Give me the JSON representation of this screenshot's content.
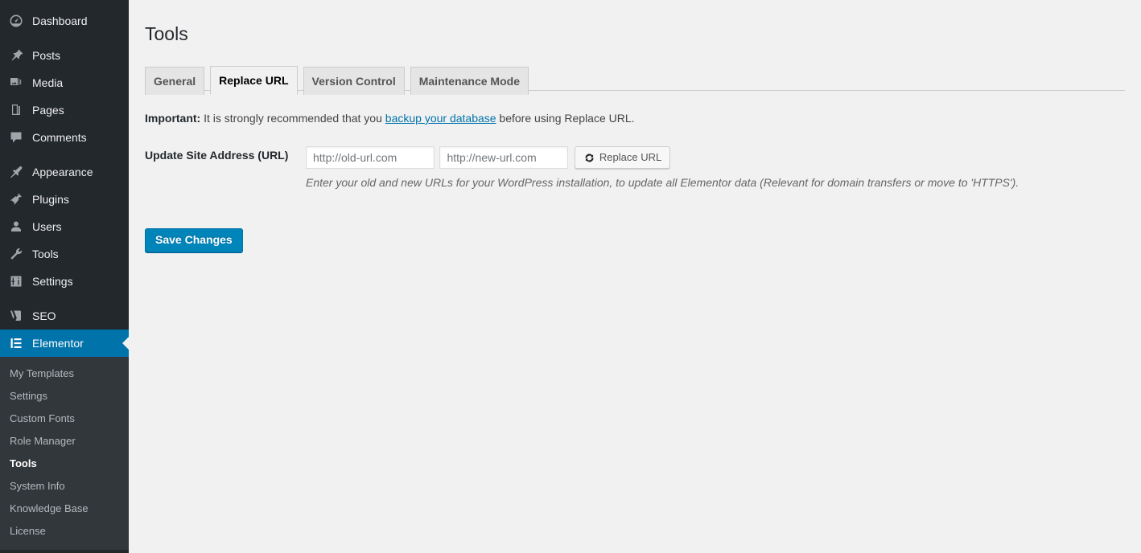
{
  "sidebar": {
    "groups": [
      {
        "items": [
          {
            "label": "Dashboard",
            "icon": "dashboard-icon",
            "active": false
          }
        ]
      },
      {
        "items": [
          {
            "label": "Posts",
            "icon": "pin-icon",
            "active": false
          },
          {
            "label": "Media",
            "icon": "media-icon",
            "active": false
          },
          {
            "label": "Pages",
            "icon": "pages-icon",
            "active": false
          },
          {
            "label": "Comments",
            "icon": "comments-icon",
            "active": false
          }
        ]
      },
      {
        "items": [
          {
            "label": "Appearance",
            "icon": "appearance-brush-icon",
            "active": false
          },
          {
            "label": "Plugins",
            "icon": "plugins-plug-icon",
            "active": false
          },
          {
            "label": "Users",
            "icon": "users-icon",
            "active": false
          },
          {
            "label": "Tools",
            "icon": "tools-wrench-icon",
            "active": false
          },
          {
            "label": "Settings",
            "icon": "settings-sliders-icon",
            "active": false
          }
        ]
      },
      {
        "items": [
          {
            "label": "SEO",
            "icon": "yoast-seo-icon",
            "active": false
          },
          {
            "label": "Elementor",
            "icon": "elementor-icon",
            "active": true
          }
        ]
      }
    ],
    "submenu": {
      "items": [
        {
          "label": "My Templates",
          "current": false
        },
        {
          "label": "Settings",
          "current": false
        },
        {
          "label": "Custom Fonts",
          "current": false
        },
        {
          "label": "Role Manager",
          "current": false
        },
        {
          "label": "Tools",
          "current": true
        },
        {
          "label": "System Info",
          "current": false
        },
        {
          "label": "Knowledge Base",
          "current": false
        },
        {
          "label": "License",
          "current": false
        }
      ]
    },
    "colors": {
      "background": "#23282d",
      "submenu_background": "#32373c",
      "active_background": "#0073aa",
      "text": "#eeeeee",
      "submenu_text": "#b4b9be"
    }
  },
  "page": {
    "title": "Tools",
    "tabs": [
      {
        "label": "General",
        "active": false
      },
      {
        "label": "Replace URL",
        "active": true
      },
      {
        "label": "Version Control",
        "active": false
      },
      {
        "label": "Maintenance Mode",
        "active": false
      }
    ],
    "notice": {
      "strong": "Important:",
      "text_before_link": " It is strongly recommended that you ",
      "link_text": "backup your database",
      "text_after_link": " before using Replace URL.",
      "link_color": "#0073aa"
    },
    "form": {
      "row_label": "Update Site Address (URL)",
      "old_url_placeholder": "http://old-url.com",
      "old_url_value": "",
      "new_url_placeholder": "http://new-url.com",
      "new_url_value": "",
      "replace_button_label": "Replace URL",
      "replace_button_icon": "update-circular-arrows-icon",
      "description": "Enter your old and new URLs for your WordPress installation, to update all Elementor data (Relevant for domain transfers or move to 'HTTPS')."
    },
    "save_button_label": "Save Changes",
    "colors": {
      "content_background": "#f1f1f1",
      "primary_button": "#0085ba",
      "tab_inactive_background": "#e5e5e5",
      "tab_border": "#cccccc"
    }
  }
}
